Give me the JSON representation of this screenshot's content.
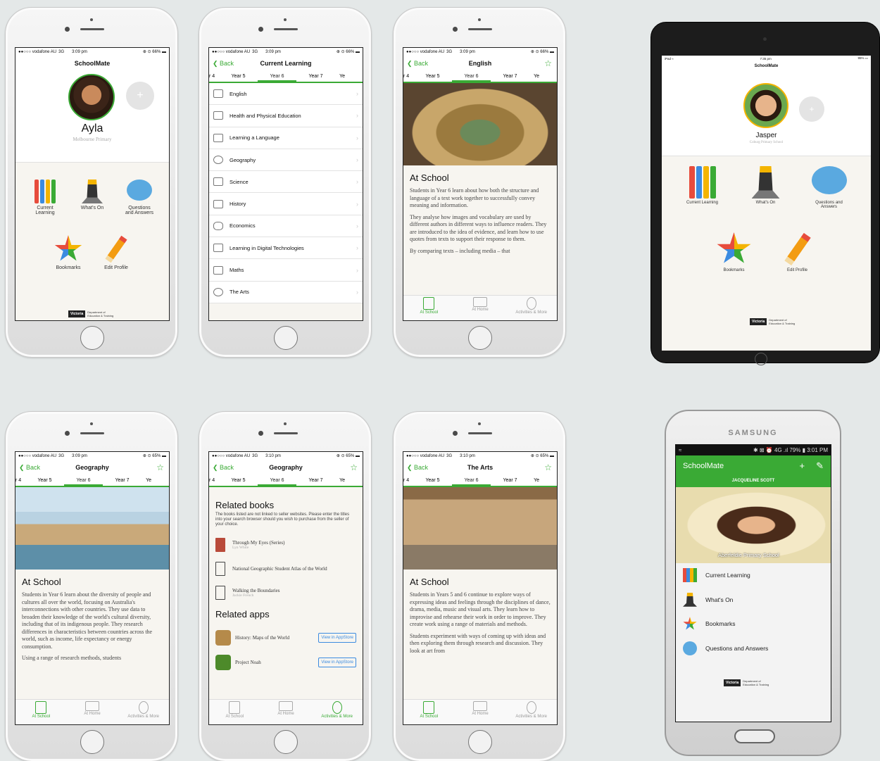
{
  "status": {
    "carrier": "●●○○○ vodafone AU",
    "network": "3G",
    "t1": "3:09 pm",
    "t2": "3:10 pm",
    "bat66": "⊕ ⊙ 66% ▬",
    "bat65": "⊕ ⊙ 65% ▬"
  },
  "tabs": {
    "year4": "r 4",
    "year5": "Year 5",
    "year6": "Year 6",
    "year7": "Year 7",
    "year8": "Ye"
  },
  "home": {
    "title": "SchoolMate",
    "name": "Ayla",
    "school": "Melbourne Primary",
    "items": {
      "current": "Current\nLearning",
      "whats_on": "What's On",
      "qa": "Questions\nand Answers",
      "bookmarks": "Bookmarks",
      "edit": "Edit Profile"
    },
    "dept": "Department of\nEducation & Training",
    "vic": "Victoria"
  },
  "curr": {
    "back": "Back",
    "title": "Current Learning",
    "subjects": [
      "English",
      "Health and Physical Education",
      "Learning a Language",
      "Geography",
      "Science",
      "History",
      "Economics",
      "Learning in Digital Technologies",
      "Maths",
      "The Arts"
    ]
  },
  "english": {
    "back": "Back",
    "title": "English",
    "section": "At School",
    "p1": "Students in Year 6 learn about how both the structure and language of a text work together to successfully convey meaning and information.",
    "p2": "They analyse how images and vocabulary are used by different authors in different ways to influence readers. They are introduced to the idea of evidence, and learn how to use quotes from texts to support their response to them.",
    "p3": "By comparing texts – including media – that"
  },
  "tabbar": {
    "school": "At School",
    "home": "At Home",
    "more": "Activities & More"
  },
  "ipad": {
    "status_left": "iPad ≈",
    "time": "7:35 pm",
    "bat": "95% ▭",
    "title": "SchoolMate",
    "name": "Jasper",
    "school": "Coburg Primary School",
    "current": "Current Learning",
    "whats_on": "What's On",
    "qa": "Questions and\nAnswers",
    "bookmarks": "Bookmarks",
    "edit": "Edit Profile"
  },
  "geo": {
    "back": "Back",
    "title": "Geography",
    "section": "At School",
    "p1": "Students in Year 6 learn about the diversity of people and cultures all over the world, focusing on Australia's interconnections with other countries. They use data to broaden their knowledge of the world's cultural diversity, including that of its indigenous people. They research differences in characteristics between countries across the world, such as income, life expectancy or energy consumption.",
    "p2": "Using a range of research methods, students"
  },
  "geo2": {
    "back": "Back",
    "title": "Geography",
    "related_books": "Related books",
    "note": "The books listed are not linked to seller websites. Please enter the titles into your search browser should you wish to purchase from the seller of your choice.",
    "books": [
      {
        "t": "Through My Eyes (Series)",
        "a": "Lyn White"
      },
      {
        "t": "National Geographic Student Atlas of the World",
        "a": ""
      },
      {
        "t": "Walking the Boundaries",
        "a": "Jackie French"
      }
    ],
    "related_apps": "Related apps",
    "apps": [
      {
        "t": "History: Maps of the World",
        "b": "View in AppStore"
      },
      {
        "t": "Project Noah",
        "b": "View in AppStore"
      }
    ]
  },
  "arts": {
    "back": "Back",
    "title": "The Arts",
    "section": "At School",
    "p1": "Students in Years 5 and 6 continue to explore ways of expressing ideas and feelings through the disciplines of dance, drama, media, music and visual arts. They learn how to improvise and rehearse their work in order to improve. They create work using a range of materials and methods.",
    "p2": "Students experiment with ways of coming up with ideas and then exploring them through research and discussion. They look at art from"
  },
  "samsung": {
    "brand": "SAMSUNG",
    "status": "✱ ⊠ ⏰ 4G .ıl 79% ▮ 3:01 PM",
    "wifi": "≈",
    "title": "SchoolMate",
    "plus": "+",
    "pencil": "✎",
    "name": "JACQUELINE SCOTT",
    "school": "Aberfeldie Primary School",
    "items": [
      "Current Learning",
      "What's On",
      "Bookmarks",
      "Questions and Answers"
    ],
    "dept": "Department of\nEducation & Training"
  }
}
